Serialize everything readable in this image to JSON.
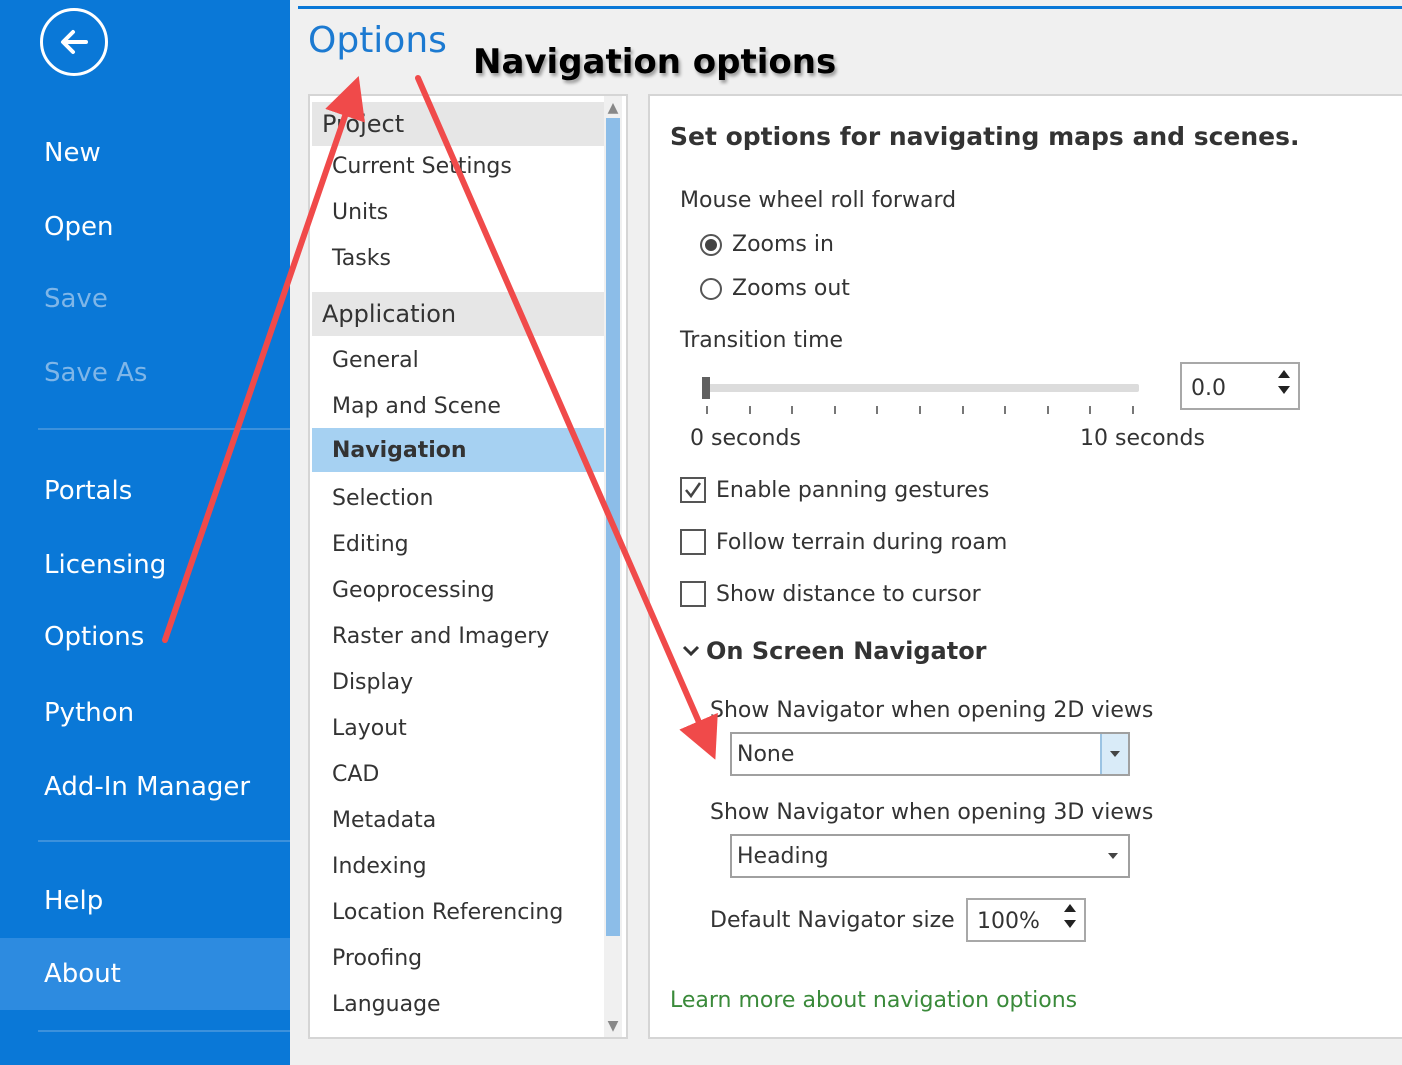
{
  "sidebar": {
    "items": [
      {
        "label": "New"
      },
      {
        "label": "Open"
      },
      {
        "label": "Save"
      },
      {
        "label": "Save As"
      },
      {
        "label": "Portals"
      },
      {
        "label": "Licensing"
      },
      {
        "label": "Options"
      },
      {
        "label": "Python"
      },
      {
        "label": "Add-In Manager"
      },
      {
        "label": "Help"
      },
      {
        "label": "About"
      }
    ]
  },
  "header": {
    "title": "Options",
    "annotation": "Navigation options"
  },
  "categories": {
    "groups": [
      "Project",
      "Application"
    ],
    "project_items": [
      "Current Settings",
      "Units",
      "Tasks"
    ],
    "application_items": [
      "General",
      "Map and Scene",
      "Navigation",
      "Selection",
      "Editing",
      "Geoprocessing",
      "Raster and Imagery",
      "Display",
      "Layout",
      "CAD",
      "Metadata",
      "Indexing",
      "Location Referencing",
      "Proofing",
      "Language"
    ],
    "selected": "Navigation"
  },
  "content": {
    "heading": "Set options for navigating maps and scenes.",
    "mouse_wheel_label": "Mouse wheel roll forward",
    "radio_zoom_in": "Zooms in",
    "radio_zoom_out": "Zooms out",
    "mouse_wheel_selected": "Zooms in",
    "transition_label": "Transition time",
    "transition_value": "0.0",
    "slider_value": 0,
    "slider_min_label": "0 seconds",
    "slider_max_label": "10 seconds",
    "cb_panning": "Enable panning gestures",
    "cb_panning_checked": true,
    "cb_terrain": "Follow terrain during roam",
    "cb_terrain_checked": false,
    "cb_distance": "Show distance to cursor",
    "cb_distance_checked": false,
    "section_navigator": "On Screen Navigator",
    "nav_2d_label": "Show Navigator when opening 2D views",
    "nav_2d_value": "None",
    "nav_3d_label": "Show Navigator when opening 3D views",
    "nav_3d_value": "Heading",
    "nav_size_label": "Default Navigator size",
    "nav_size_value": "100%",
    "learn_more": "Learn more about navigation options"
  },
  "colors": {
    "sidebar_bg": "#0a78d7",
    "selected_category": "#a6d1f2",
    "title_blue": "#1c7ad1",
    "link_green": "#3a8a3a",
    "annotation_arrow": "#f04a4a"
  }
}
